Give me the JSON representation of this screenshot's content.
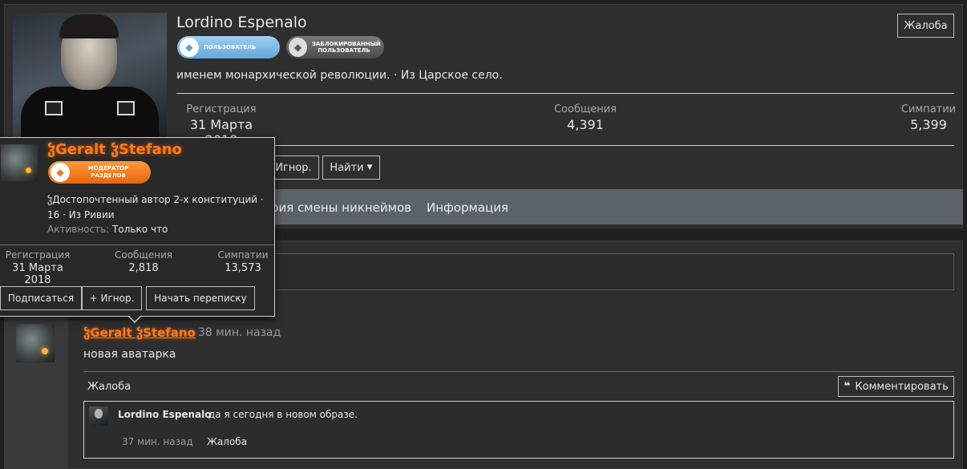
{
  "profile": {
    "name": "Lordino Espenalo",
    "badges": [
      "ПОЛЬЗОВАТЕЛЬ",
      "ЗАБЛОКИРОВАННЫЙ ПОЛЬЗОВАТЕЛЬ"
    ],
    "title": "именем монархической революции. · Из Царское село.",
    "report_label": "Жалоба",
    "stats": {
      "registration_label": "Регистрация",
      "registration_value": "31 Марта 2018",
      "messages_label": "Сообщения",
      "messages_value": "4,391",
      "likes_label": "Симпатии",
      "likes_value": "5,399"
    },
    "actions": {
      "ignore": "Игнор.",
      "find": "Найти"
    },
    "tabs": [
      "рия смены никнеймов",
      "Информация"
    ]
  },
  "post": {
    "author": "ჴGeralt ჴStefano",
    "time": "· 38 мин. назад",
    "text": "новая аватарка",
    "report_label": "Жалоба",
    "comment_button": "Комментировать",
    "comment": {
      "author": "Lordino Espenalo",
      "text": "да я сегодня в новом образе.",
      "time": "37 мин. назад",
      "report_label": "Жалоба"
    }
  },
  "hovercard": {
    "name": "ჴGeralt ჴStefano",
    "badge": "МОДЕРАТОР РАЗДЕЛОВ",
    "title_line1": "ჴДостопочтенный автор 2-х конституций ·",
    "title_line2": "16 · Из Ривии",
    "activity_label": "Активность:",
    "activity_value": "Только что",
    "stats": {
      "registration_label": "Регистрация",
      "registration_value": "31 Марта 2018",
      "messages_label": "Сообщения",
      "messages_value": "2,818",
      "likes_label": "Симпатии",
      "likes_value": "13,573"
    },
    "buttons": {
      "subscribe": "Подписаться",
      "ignore": "+ Игнор.",
      "message": "Начать переписку"
    }
  },
  "colors": {
    "accent_orange": "#ff7a1a",
    "tab_bar": "#5b6268",
    "badge_user": "#63a7d8"
  }
}
